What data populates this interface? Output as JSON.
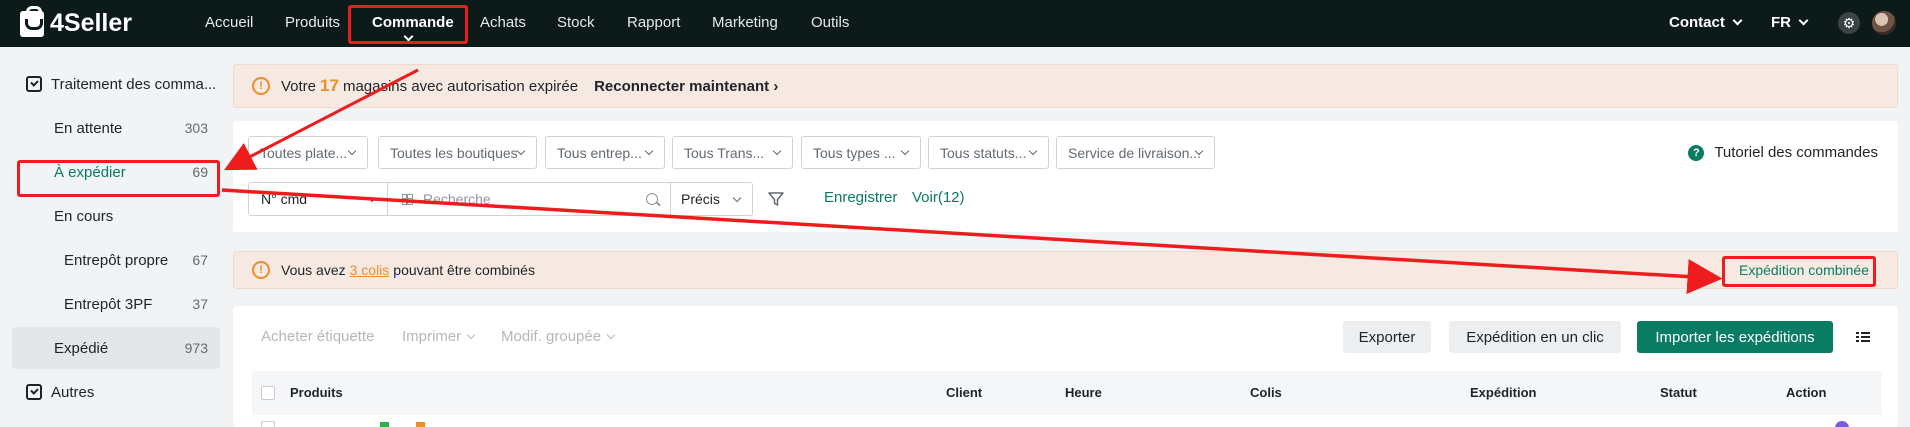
{
  "topnav": {
    "brand": "4Seller",
    "items": [
      "Accueil",
      "Produits",
      "Commande",
      "Achats",
      "Stock",
      "Rapport",
      "Marketing",
      "Outils"
    ],
    "active": "Commande",
    "contact": "Contact",
    "language": "FR"
  },
  "sidebar": {
    "section_orders": "Traitement des comma...",
    "items": [
      {
        "label": "En attente",
        "count": "303"
      },
      {
        "label": "À expédier",
        "count": "69"
      },
      {
        "label": "En cours",
        "count": ""
      },
      {
        "label": "Entrepôt propre",
        "count": "67"
      },
      {
        "label": "Entrepôt 3PF",
        "count": "37"
      },
      {
        "label": "Expédié",
        "count": "973"
      }
    ],
    "section_other": "Autres"
  },
  "banner1": {
    "prefix": "Votre",
    "count": "17",
    "suffix": "magasins avec autorisation expirée",
    "action": "Reconnecter maintenant"
  },
  "filters": {
    "dropdowns": [
      "Toutes plate...",
      "Toutes les boutiques",
      "Tous entrep...",
      "Tous Trans...",
      "Tous types ...",
      "Tous statuts...",
      "Service de livraison..."
    ],
    "tutorial": "Tutoriel des commandes",
    "search_field": "N° cmd",
    "search_placeholder": "Recherche",
    "match_mode": "Précis",
    "save": "Enregistrer",
    "view": "Voir(12)"
  },
  "banner2": {
    "prefix": "Vous avez",
    "link": "3 colis",
    "suffix": "pouvant être combinés",
    "action": "Expédition combinée"
  },
  "toolbar": {
    "buy_label": "Acheter étiquette",
    "print": "Imprimer",
    "bulk_edit": "Modif. groupée",
    "export": "Exporter",
    "one_click": "Expédition en un clic",
    "import": "Importer les expéditions"
  },
  "table": {
    "columns": [
      "Produits",
      "Client",
      "Heure",
      "Colis",
      "Expédition",
      "Statut",
      "Action"
    ]
  },
  "colors": {
    "nav_bg": "#0d1a1a",
    "accent_green": "#0a7c63",
    "warning_orange": "#f08c2a",
    "annotation_red": "#ee1c1c"
  }
}
